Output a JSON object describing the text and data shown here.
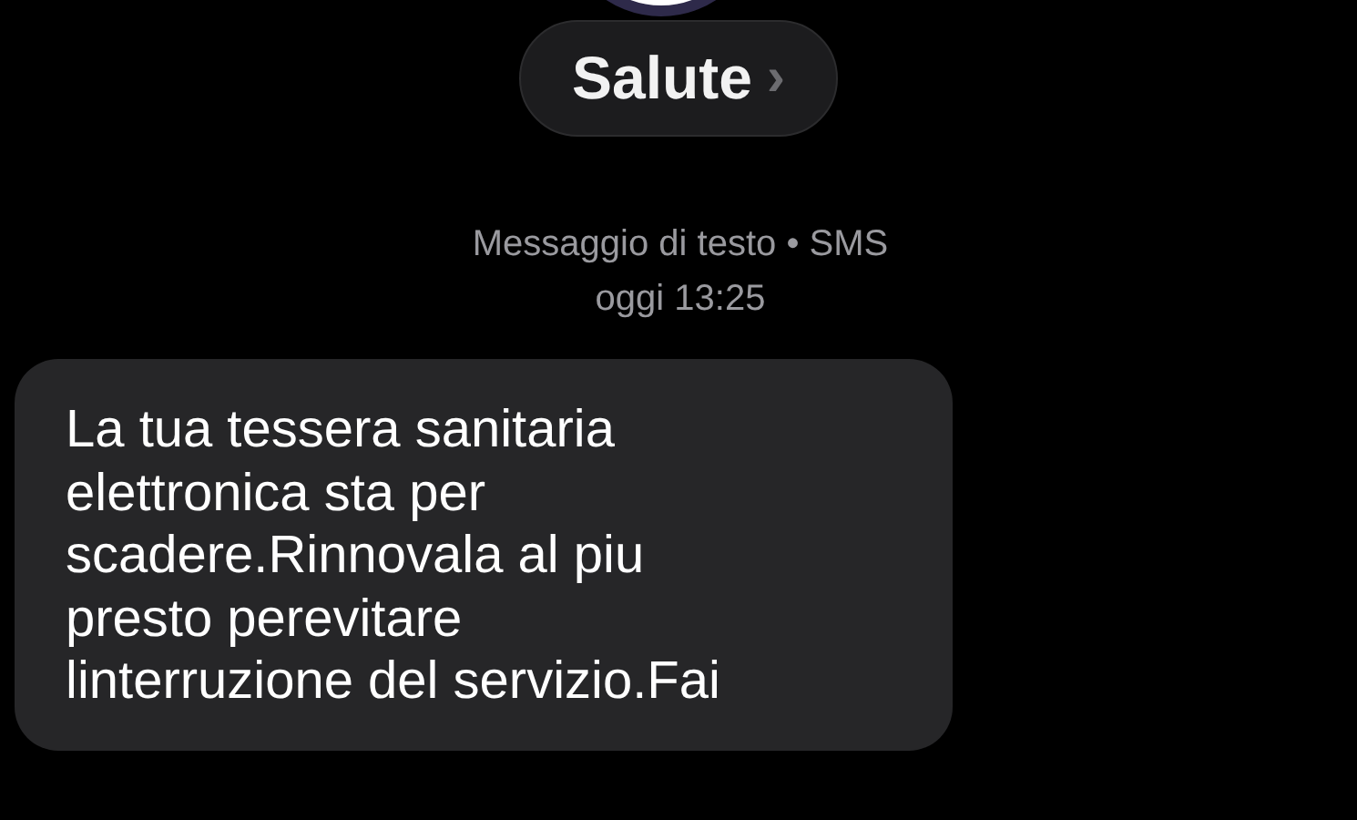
{
  "contact": {
    "name": "Salute",
    "chevron": "›"
  },
  "meta": {
    "service": "Messaggio di testo • SMS",
    "time": "oggi 13:25"
  },
  "messages": [
    {
      "kind": "incoming",
      "text": "La tua tessera sanitaria\nelettronica sta per\nscadere.Rinnovala al piu\npresto perevitare\nlinterruzione del servizio.Fai"
    }
  ]
}
